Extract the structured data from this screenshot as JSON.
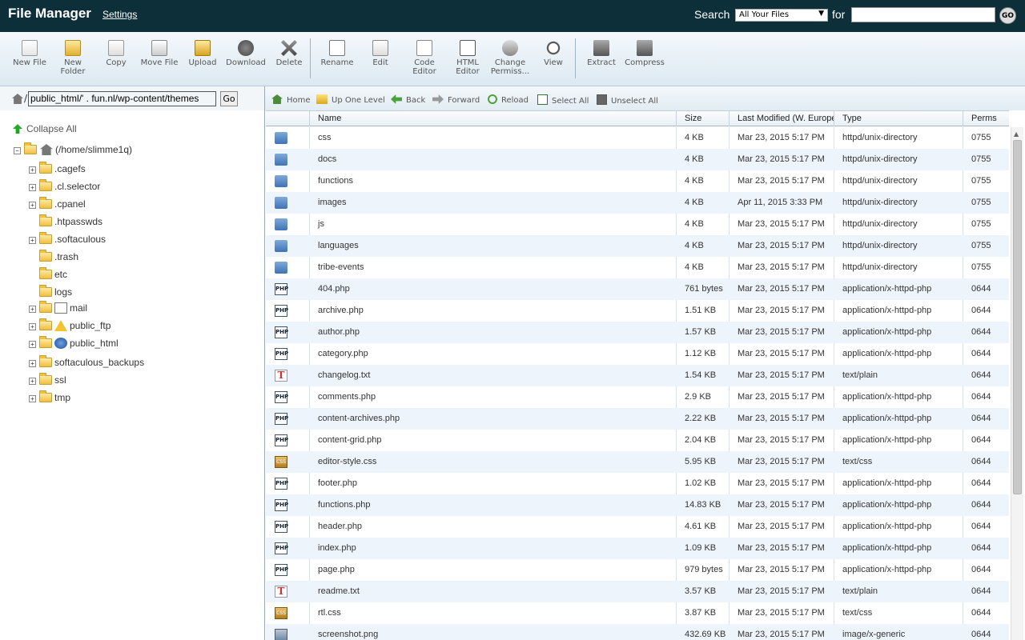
{
  "header": {
    "title": "File Manager",
    "settings_link": "Settings",
    "search_label": "Search",
    "search_scope": "All Your Files",
    "for_label": "for",
    "search_value": "",
    "go_label": "GO"
  },
  "toolbar": {
    "items": [
      {
        "label": "New File",
        "icon": "new-file-icon"
      },
      {
        "label": "New Folder",
        "icon": "new-folder-icon"
      },
      {
        "label": "Copy",
        "icon": "copy-icon"
      },
      {
        "label": "Move File",
        "icon": "move-file-icon"
      },
      {
        "label": "Upload",
        "icon": "upload-icon"
      },
      {
        "label": "Download",
        "icon": "download-icon"
      },
      {
        "label": "Delete",
        "icon": "delete-icon"
      },
      {
        "label": "Rename",
        "icon": "rename-icon"
      },
      {
        "label": "Edit",
        "icon": "edit-icon"
      },
      {
        "label": "Code Editor",
        "icon": "code-editor-icon"
      },
      {
        "label": "HTML Editor",
        "icon": "html-editor-icon"
      },
      {
        "label": "Change Permiss...",
        "icon": "change-permissions-icon"
      },
      {
        "label": "View",
        "icon": "view-icon"
      },
      {
        "label": "Extract",
        "icon": "extract-icon"
      },
      {
        "label": "Compress",
        "icon": "compress-icon"
      }
    ]
  },
  "path": {
    "value": "public_html/'  .  fun.nl/wp-content/themes",
    "go_label": "Go"
  },
  "nav": {
    "home": "Home",
    "up": "Up One Level",
    "back": "Back",
    "forward": "Forward",
    "reload": "Reload",
    "select_all": "Select All",
    "unselect_all": "Unselect All"
  },
  "tree": {
    "collapse_all": "Collapse All",
    "root": "(/home/slimme1q)",
    "nodes": [
      {
        "name": ".cagefs",
        "expandable": true
      },
      {
        "name": ".cl.selector",
        "expandable": true
      },
      {
        "name": ".cpanel",
        "expandable": true
      },
      {
        "name": ".htpasswds",
        "expandable": false
      },
      {
        "name": ".softaculous",
        "expandable": true
      },
      {
        "name": ".trash",
        "expandable": false
      },
      {
        "name": "etc",
        "expandable": false
      },
      {
        "name": "logs",
        "expandable": false
      },
      {
        "name": "mail",
        "expandable": true
      },
      {
        "name": "public_ftp",
        "expandable": true
      },
      {
        "name": "public_html",
        "expandable": true
      },
      {
        "name": "softaculous_backups",
        "expandable": true
      },
      {
        "name": "ssl",
        "expandable": true
      },
      {
        "name": "tmp",
        "expandable": true
      }
    ]
  },
  "table": {
    "columns": [
      "Name",
      "Size",
      "Last Modified (W. Europe",
      "Type",
      "Perms"
    ],
    "rows": [
      {
        "icon": "dir",
        "name": "css",
        "size": "4 KB",
        "modified": "Mar 23, 2015 5:17 PM",
        "type": "httpd/unix-directory",
        "perms": "0755"
      },
      {
        "icon": "dir",
        "name": "docs",
        "size": "4 KB",
        "modified": "Mar 23, 2015 5:17 PM",
        "type": "httpd/unix-directory",
        "perms": "0755"
      },
      {
        "icon": "dir",
        "name": "functions",
        "size": "4 KB",
        "modified": "Mar 23, 2015 5:17 PM",
        "type": "httpd/unix-directory",
        "perms": "0755"
      },
      {
        "icon": "dir",
        "name": "images",
        "size": "4 KB",
        "modified": "Apr 11, 2015 3:33 PM",
        "type": "httpd/unix-directory",
        "perms": "0755"
      },
      {
        "icon": "dir",
        "name": "js",
        "size": "4 KB",
        "modified": "Mar 23, 2015 5:17 PM",
        "type": "httpd/unix-directory",
        "perms": "0755"
      },
      {
        "icon": "dir",
        "name": "languages",
        "size": "4 KB",
        "modified": "Mar 23, 2015 5:17 PM",
        "type": "httpd/unix-directory",
        "perms": "0755"
      },
      {
        "icon": "dir",
        "name": "tribe-events",
        "size": "4 KB",
        "modified": "Mar 23, 2015 5:17 PM",
        "type": "httpd/unix-directory",
        "perms": "0755"
      },
      {
        "icon": "php",
        "name": "404.php",
        "size": "761 bytes",
        "modified": "Mar 23, 2015 5:17 PM",
        "type": "application/x-httpd-php",
        "perms": "0644"
      },
      {
        "icon": "php",
        "name": "archive.php",
        "size": "1.51 KB",
        "modified": "Mar 23, 2015 5:17 PM",
        "type": "application/x-httpd-php",
        "perms": "0644"
      },
      {
        "icon": "php",
        "name": "author.php",
        "size": "1.57 KB",
        "modified": "Mar 23, 2015 5:17 PM",
        "type": "application/x-httpd-php",
        "perms": "0644"
      },
      {
        "icon": "php",
        "name": "category.php",
        "size": "1.12 KB",
        "modified": "Mar 23, 2015 5:17 PM",
        "type": "application/x-httpd-php",
        "perms": "0644"
      },
      {
        "icon": "txt",
        "name": "changelog.txt",
        "size": "1.54 KB",
        "modified": "Mar 23, 2015 5:17 PM",
        "type": "text/plain",
        "perms": "0644"
      },
      {
        "icon": "php",
        "name": "comments.php",
        "size": "2.9 KB",
        "modified": "Mar 23, 2015 5:17 PM",
        "type": "application/x-httpd-php",
        "perms": "0644"
      },
      {
        "icon": "php",
        "name": "content-archives.php",
        "size": "2.22 KB",
        "modified": "Mar 23, 2015 5:17 PM",
        "type": "application/x-httpd-php",
        "perms": "0644"
      },
      {
        "icon": "php",
        "name": "content-grid.php",
        "size": "2.04 KB",
        "modified": "Mar 23, 2015 5:17 PM",
        "type": "application/x-httpd-php",
        "perms": "0644"
      },
      {
        "icon": "css",
        "name": "editor-style.css",
        "size": "5.95 KB",
        "modified": "Mar 23, 2015 5:17 PM",
        "type": "text/css",
        "perms": "0644"
      },
      {
        "icon": "php",
        "name": "footer.php",
        "size": "1.02 KB",
        "modified": "Mar 23, 2015 5:17 PM",
        "type": "application/x-httpd-php",
        "perms": "0644"
      },
      {
        "icon": "php",
        "name": "functions.php",
        "size": "14.83 KB",
        "modified": "Mar 23, 2015 5:17 PM",
        "type": "application/x-httpd-php",
        "perms": "0644"
      },
      {
        "icon": "php",
        "name": "header.php",
        "size": "4.61 KB",
        "modified": "Mar 23, 2015 5:17 PM",
        "type": "application/x-httpd-php",
        "perms": "0644"
      },
      {
        "icon": "php",
        "name": "index.php",
        "size": "1.09 KB",
        "modified": "Mar 23, 2015 5:17 PM",
        "type": "application/x-httpd-php",
        "perms": "0644"
      },
      {
        "icon": "php",
        "name": "page.php",
        "size": "979 bytes",
        "modified": "Mar 23, 2015 5:17 PM",
        "type": "application/x-httpd-php",
        "perms": "0644"
      },
      {
        "icon": "txt",
        "name": "readme.txt",
        "size": "3.57 KB",
        "modified": "Mar 23, 2015 5:17 PM",
        "type": "text/plain",
        "perms": "0644"
      },
      {
        "icon": "css",
        "name": "rtl.css",
        "size": "3.87 KB",
        "modified": "Mar 23, 2015 5:17 PM",
        "type": "text/css",
        "perms": "0644"
      },
      {
        "icon": "img",
        "name": "screenshot.png",
        "size": "432.69 KB",
        "modified": "Mar 23, 2015 5:17 PM",
        "type": "image/x-generic",
        "perms": "0644"
      }
    ]
  },
  "colors": {
    "header_bg": "#0d2f3a",
    "row_alt": "#eef4fb",
    "toolbar_bg": "#dce9f2"
  }
}
